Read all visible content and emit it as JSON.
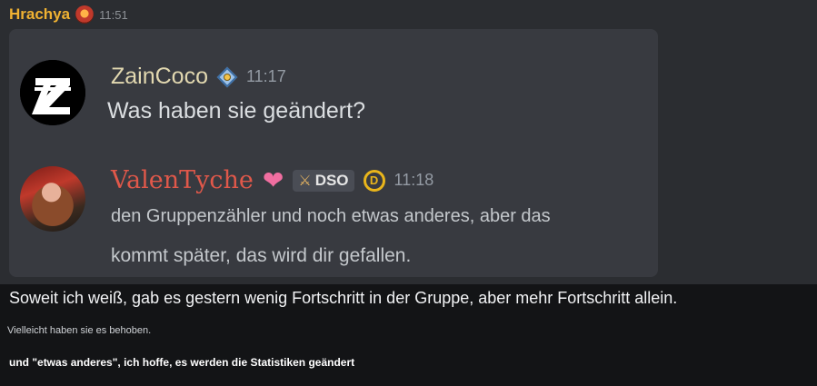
{
  "header": {
    "author": "Hrachya",
    "time": "11:51",
    "badge_icon": "devil-emoji-icon"
  },
  "quoted_messages": [
    {
      "avatar_icon": "zaincoco-logo-avatar",
      "author": "ZainCoco",
      "badge_icon": "compass-badge-icon",
      "time": "11:17",
      "lines": [
        "Was haben sie geändert?"
      ]
    },
    {
      "avatar_icon": "red-hair-portrait-avatar",
      "author": "ValenTyche",
      "heart": "❤",
      "tag": "DSO",
      "tag_icon": "sword-icon",
      "boost_icon": "server-boost-icon",
      "time": "11:18",
      "lines": [
        "den Gruppenzähler und noch etwas anderes, aber das",
        "kommt später, das wird dir gefallen."
      ]
    }
  ],
  "reply": {
    "main": "Soweit ich weiß, gab es gestern wenig Fortschritt in der Gruppe, aber mehr Fortschritt allein.",
    "small": "Vielleicht haben sie es behoben.",
    "bold": "und \"etwas anderes\", ich hoffe, es werden die Statistiken geändert"
  },
  "colors": {
    "author_hrachya": "#f0b232",
    "author_zaincoco": "#e2d8b0",
    "author_valentyche": "#e0584a",
    "card_bg": "#383a40",
    "bg": "#2b2d31"
  }
}
